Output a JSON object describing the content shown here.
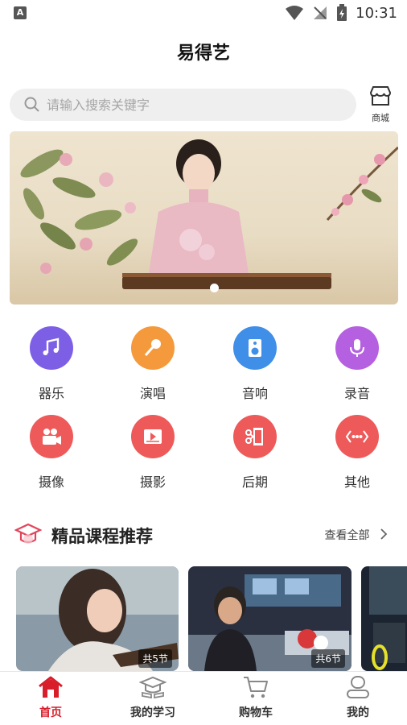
{
  "status": {
    "indicator": "A",
    "time": "10:31"
  },
  "app_title": "易得艺",
  "search": {
    "placeholder": "请输入搜索关键字"
  },
  "shop": {
    "label": "商城"
  },
  "categories": [
    {
      "label": "器乐",
      "icon": "music-notes-icon",
      "color": "#7d5fe6"
    },
    {
      "label": "演唱",
      "icon": "microphone-icon",
      "color": "#f59a3c"
    },
    {
      "label": "音响",
      "icon": "speaker-icon",
      "color": "#3f8fe8"
    },
    {
      "label": "录音",
      "icon": "recording-mic-icon",
      "color": "#b560e0"
    },
    {
      "label": "摄像",
      "icon": "video-camera-icon",
      "color": "#ee5a5a"
    },
    {
      "label": "摄影",
      "icon": "play-screen-icon",
      "color": "#ee5a5a"
    },
    {
      "label": "后期",
      "icon": "film-edit-icon",
      "color": "#ee5a5a"
    },
    {
      "label": "其他",
      "icon": "more-dots-icon",
      "color": "#ee5a5a"
    }
  ],
  "section": {
    "title": "精品课程推荐",
    "see_all": "查看全部"
  },
  "courses": [
    {
      "badge": "共5节"
    },
    {
      "badge": "共6节"
    }
  ],
  "nav": [
    {
      "label": "首页",
      "icon": "home-icon",
      "active": true
    },
    {
      "label": "我的学习",
      "icon": "study-cap-icon",
      "active": false
    },
    {
      "label": "购物车",
      "icon": "cart-icon",
      "active": false
    },
    {
      "label": "我的",
      "icon": "user-icon",
      "active": false
    }
  ],
  "colors": {
    "accent": "#d81e2a",
    "search_bg": "#efefef"
  }
}
